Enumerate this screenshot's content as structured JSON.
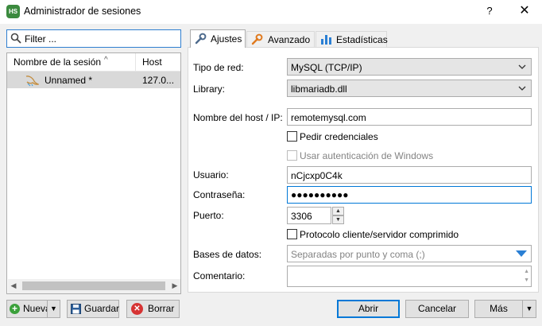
{
  "window": {
    "title": "Administrador de sesiones",
    "app_icon_text": "HS",
    "help_label": "?",
    "close_label": "✕"
  },
  "filter": {
    "placeholder": "Filter ..."
  },
  "session_list": {
    "columns": [
      "Nombre de la sesión",
      "Host"
    ],
    "sort_glyph": "^",
    "rows": [
      {
        "name": "Unnamed *",
        "host": "127.0...",
        "selected": true
      }
    ]
  },
  "tabs": [
    {
      "label": "Ajustes",
      "active": true,
      "icon": "wrench-icon"
    },
    {
      "label": "Avanzado",
      "active": false,
      "icon": "orange-wrench-icon"
    },
    {
      "label": "Estadísticas",
      "active": false,
      "icon": "bar-chart-icon"
    }
  ],
  "settings": {
    "network_type": {
      "label": "Tipo de red:",
      "value": "MySQL (TCP/IP)"
    },
    "library": {
      "label": "Library:",
      "value": "libmariadb.dll"
    },
    "host": {
      "label": "Nombre del host / IP:",
      "value": "remotemysql.com"
    },
    "ask_credentials": {
      "label": "Pedir credenciales",
      "checked": false
    },
    "windows_auth": {
      "label": "Usar autenticación de Windows",
      "checked": false,
      "disabled": true
    },
    "user": {
      "label": "Usuario:",
      "value": "nCjcxp0C4k"
    },
    "password": {
      "label": "Contraseña:",
      "value": "●●●●●●●●●●"
    },
    "port": {
      "label": "Puerto:",
      "value": "3306"
    },
    "compressed": {
      "label": "Protocolo cliente/servidor comprimido",
      "checked": false
    },
    "databases": {
      "label": "Bases de datos:",
      "placeholder": "Separadas por punto y coma (;)"
    },
    "comment": {
      "label": "Comentario:",
      "value": ""
    }
  },
  "buttons": {
    "new": "Nueva",
    "save": "Guardar",
    "delete": "Borrar",
    "open": "Abrir",
    "cancel": "Cancelar",
    "more": "Más",
    "dropdown_glyph": "▼"
  },
  "colors": {
    "accent": "#0078d7",
    "selection": "#d9d9d9",
    "new_icon": "#3aa03a",
    "delete_icon": "#d63333"
  }
}
